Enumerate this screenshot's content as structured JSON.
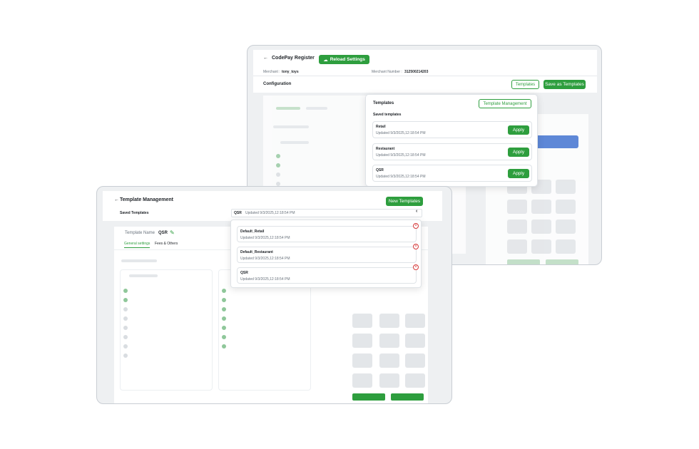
{
  "register": {
    "back_arrow": "←",
    "title": "CodePay Register",
    "reload_button": "Reload Settings",
    "merchant_label": "Merchant :",
    "merchant_value": "tony_toys",
    "merchant_number_label": "Merchant Number :",
    "merchant_number_value": "312500214203",
    "section_title": "Configuration",
    "templates_button": "Templates",
    "save_as_templates_button": "Save as Templates"
  },
  "templates_popup": {
    "title": "Templates",
    "management_button": "Template Management",
    "saved_label": "Saved templates",
    "items": [
      {
        "name": "Retail",
        "updated": "Updated 9/3/2025,12:18:54 PM",
        "action": "Apply"
      },
      {
        "name": "Restaurant",
        "updated": "Updated 9/3/2025,12:18:54 PM",
        "action": "Apply"
      },
      {
        "name": "QSR",
        "updated": "Updated 9/3/2025,12:18:54 PM",
        "action": "Apply"
      }
    ]
  },
  "management": {
    "back_arrow": "←",
    "title": "Template Management",
    "new_button": "New Templates",
    "saved_label": "Saved Templates",
    "selected_name": "QSR",
    "selected_updated": "Updated 9/3/2025,12:18:54 PM",
    "chevron": "‹",
    "template_name_label": "Template Name",
    "template_name_value": "QSR",
    "tabs": [
      "General settings",
      "Fees & Others"
    ],
    "dropdown_items": [
      {
        "name": "Default_Retail",
        "updated": "Updated 9/3/2025,12:18:54 PM"
      },
      {
        "name": "Default_Restaurant",
        "updated": "Updated 9/3/2025,12:18:54 PM"
      },
      {
        "name": "QSR",
        "updated": "Updated 9/3/2025,12:18:54 PM"
      }
    ],
    "remove_glyph": "×"
  }
}
